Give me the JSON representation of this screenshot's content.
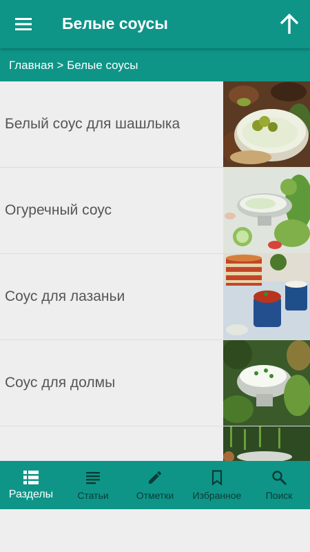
{
  "header": {
    "title": "Белые соусы",
    "menu_icon": "hamburger-menu-icon",
    "up_icon": "arrow-up-icon"
  },
  "breadcrumb": "Главная > Белые соусы",
  "recipes": [
    {
      "title": "Белый соус для шашлыка"
    },
    {
      "title": "Огуречный соус"
    },
    {
      "title": "Соус для лазаньи"
    },
    {
      "title": "Соус для долмы"
    },
    {
      "title": ""
    }
  ],
  "bottom_nav": {
    "active": "sections",
    "items": [
      {
        "id": "sections",
        "label": "Разделы",
        "icon": "view-list-icon"
      },
      {
        "id": "articles",
        "label": "Статьи",
        "icon": "article-lines-icon"
      },
      {
        "id": "notes",
        "label": "Отметки",
        "icon": "pencil-icon"
      },
      {
        "id": "favorites",
        "label": "Избранное",
        "icon": "bookmark-icon"
      },
      {
        "id": "search",
        "label": "Поиск",
        "icon": "search-icon"
      }
    ]
  },
  "colors": {
    "primary": "#0e9588",
    "background": "#eeeeee",
    "inactive_nav": "#0a3b35",
    "text": "#555555"
  }
}
